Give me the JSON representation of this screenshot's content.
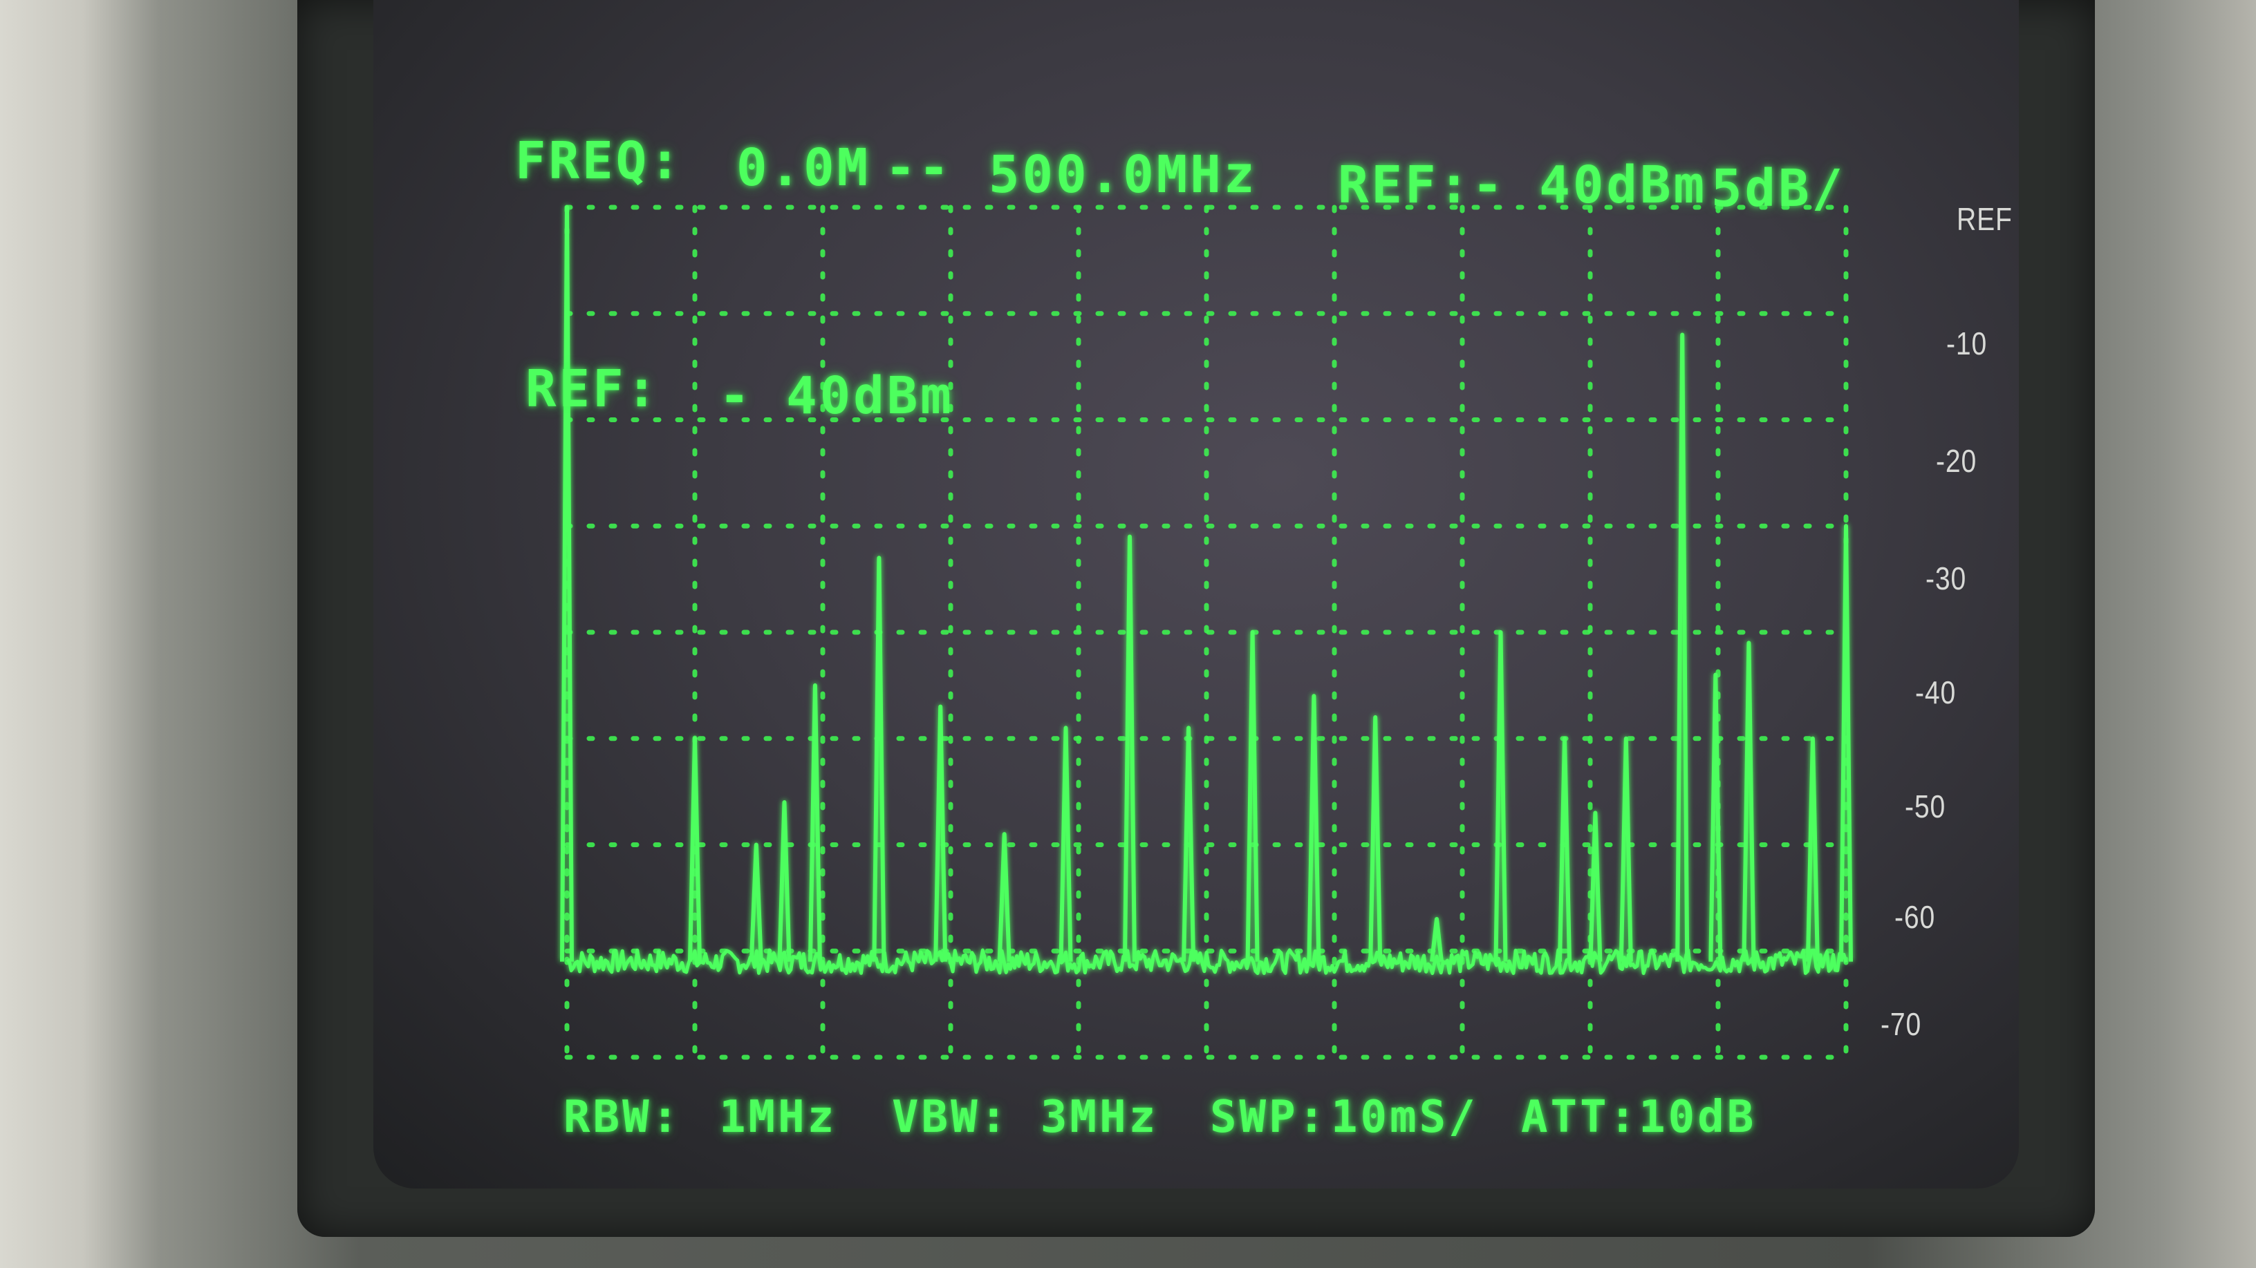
{
  "instrument": {
    "freq_label": "FREQ:",
    "freq_start": "0.0M",
    "freq_sep": "--",
    "freq_stop": "500.0MHz",
    "ref_header": "REF:- 40dBm",
    "scale_per_div": "5dB/",
    "ref_overlay_label": "REF:",
    "ref_overlay_value": "- 40dBm",
    "rbw_label": "RBW:",
    "rbw_value": "1MHz",
    "vbw_label": "VBW:",
    "vbw_value": "3MHz",
    "swp_label": "SWP:",
    "swp_value": "10mS/",
    "att_label": "ATT:10dB"
  },
  "bezel_scale": {
    "labels": [
      "REF",
      "-10",
      "-20",
      "-30",
      "-40",
      "-50",
      "-60",
      "-70"
    ]
  },
  "colors": {
    "trace": "#4dff5e",
    "graticule": "#3ef050",
    "screen_bg": "#3c3a42"
  },
  "chart_data": {
    "type": "line",
    "x_unit": "MHz",
    "y_unit": "dB below REF",
    "xlim": [
      0,
      500
    ],
    "ylim": [
      -80,
      0
    ],
    "noise_floor": -71,
    "grid": true,
    "peaks": [
      {
        "x": 0,
        "y": 0
      },
      {
        "x": 50,
        "y": -50
      },
      {
        "x": 74,
        "y": -60
      },
      {
        "x": 85,
        "y": -56
      },
      {
        "x": 97,
        "y": -45
      },
      {
        "x": 122,
        "y": -33
      },
      {
        "x": 146,
        "y": -47
      },
      {
        "x": 171,
        "y": -59
      },
      {
        "x": 195,
        "y": -49
      },
      {
        "x": 220,
        "y": -31
      },
      {
        "x": 243,
        "y": -49
      },
      {
        "x": 268,
        "y": -40
      },
      {
        "x": 292,
        "y": -46
      },
      {
        "x": 316,
        "y": -48
      },
      {
        "x": 340,
        "y": -67
      },
      {
        "x": 365,
        "y": -40
      },
      {
        "x": 390,
        "y": -50
      },
      {
        "x": 402,
        "y": -57
      },
      {
        "x": 414,
        "y": -50
      },
      {
        "x": 436,
        "y": -12
      },
      {
        "x": 449,
        "y": -44
      },
      {
        "x": 462,
        "y": -41
      },
      {
        "x": 487,
        "y": -50
      },
      {
        "x": 500,
        "y": -30
      }
    ]
  }
}
